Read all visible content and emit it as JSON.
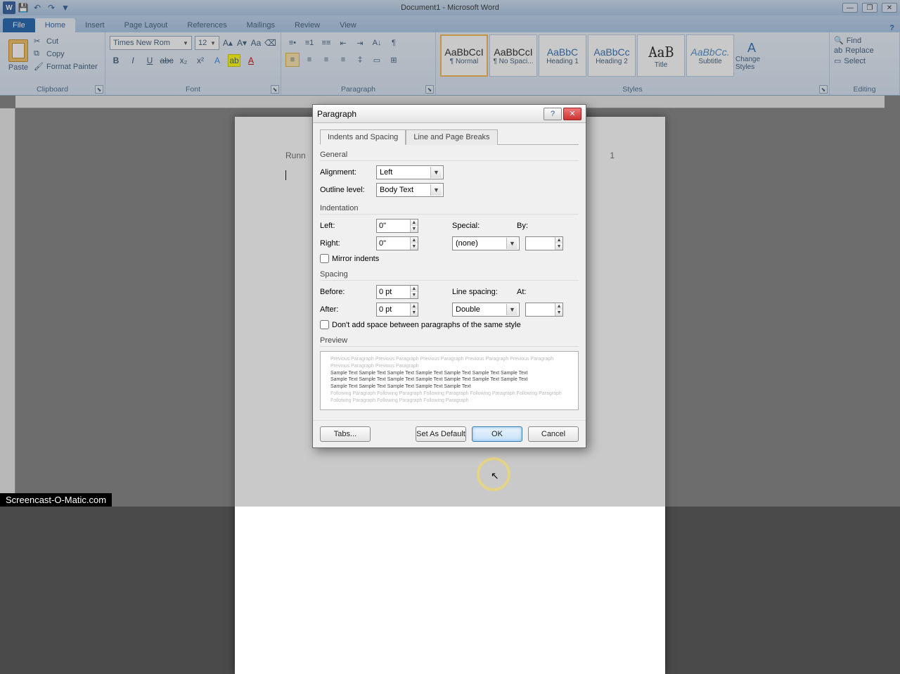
{
  "titlebar": {
    "title": "Document1 - Microsoft Word"
  },
  "ribbon": {
    "file": "File",
    "tabs": [
      "Home",
      "Insert",
      "Page Layout",
      "References",
      "Mailings",
      "Review",
      "View"
    ],
    "active_tab": "Home",
    "clipboard": {
      "label": "Clipboard",
      "paste": "Paste",
      "cut": "Cut",
      "copy": "Copy",
      "format_painter": "Format Painter"
    },
    "font": {
      "label": "Font",
      "name": "Times New Rom",
      "size": "12"
    },
    "paragraph": {
      "label": "Paragraph"
    },
    "styles": {
      "label": "Styles",
      "items": [
        {
          "preview": "AaBbCcI",
          "name": "¶ Normal"
        },
        {
          "preview": "AaBbCcI",
          "name": "¶ No Spaci..."
        },
        {
          "preview": "AaBbC",
          "name": "Heading 1"
        },
        {
          "preview": "AaBbCc",
          "name": "Heading 2"
        },
        {
          "preview": "AaB",
          "name": "Title"
        },
        {
          "preview": "AaBbCc.",
          "name": "Subtitle"
        }
      ],
      "change": "Change Styles"
    },
    "editing": {
      "label": "Editing",
      "find": "Find",
      "replace": "Replace",
      "select": "Select"
    }
  },
  "page": {
    "header_left": "Runn",
    "header_right": "1"
  },
  "dialog": {
    "title": "Paragraph",
    "tab1": "Indents and Spacing",
    "tab2": "Line and Page Breaks",
    "general": {
      "label": "General",
      "alignment_lbl": "Alignment:",
      "alignment": "Left",
      "outline_lbl": "Outline level:",
      "outline": "Body Text"
    },
    "indent": {
      "label": "Indentation",
      "left_lbl": "Left:",
      "left": "0\"",
      "right_lbl": "Right:",
      "right": "0\"",
      "special_lbl": "Special:",
      "special": "(none)",
      "by_lbl": "By:",
      "by": "",
      "mirror": "Mirror indents"
    },
    "spacing": {
      "label": "Spacing",
      "before_lbl": "Before:",
      "before": "0 pt",
      "after_lbl": "After:",
      "after": "0 pt",
      "line_lbl": "Line spacing:",
      "line": "Double",
      "at_lbl": "At:",
      "at": "",
      "dont_add": "Don't add space between paragraphs of the same style"
    },
    "preview": {
      "label": "Preview",
      "sample": "Sample Text Sample Text Sample Text Sample Text Sample Text Sample Text Sample Text"
    },
    "buttons": {
      "tabs": "Tabs...",
      "setdefault": "Set As Default",
      "ok": "OK",
      "cancel": "Cancel"
    }
  },
  "watermark": "Screencast-O-Matic.com"
}
